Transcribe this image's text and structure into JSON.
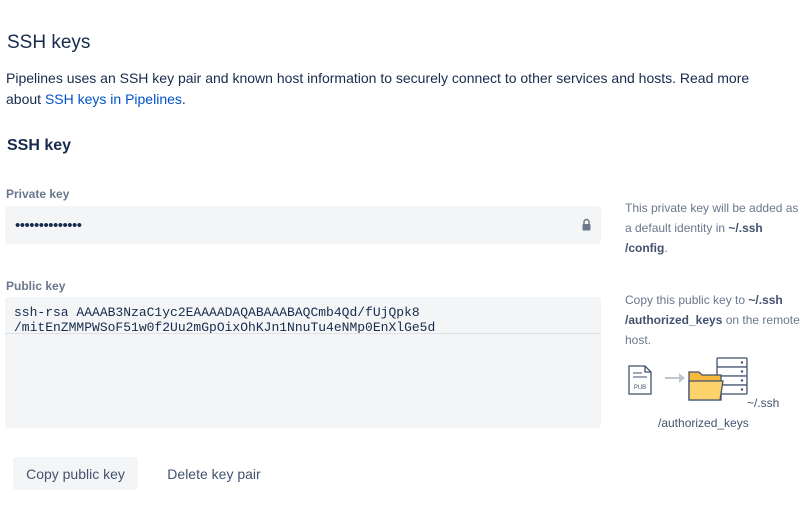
{
  "header": {
    "title": "SSH keys",
    "intro_text": "Pipelines uses an SSH key pair and known host information to securely connect to other services and hosts. Read more about ",
    "intro_link": "SSH keys in Pipelines",
    "intro_end": "."
  },
  "section": {
    "title": "SSH key"
  },
  "private_key": {
    "label": "Private key",
    "masked_value": "••••••••••••••",
    "help_prefix": "This private key will be added as a default identity in ",
    "help_path": "~/.ssh /config",
    "help_suffix": "."
  },
  "public_key": {
    "label": "Public key",
    "value": "ssh-rsa AAAAB3NzaC1yc2EAAAADAQABAAABAQCmb4Qd/fUjQpk8\n/mitEnZMMPWSoF51w0f2Uu2mGpOixOhKJn1NnuTu4eNMp0EnXlGe5d",
    "help_prefix": "Copy this public key to ",
    "help_path": "~/.ssh /authorized_keys",
    "help_suffix": " on the remote host.",
    "illustration": {
      "file_label": "PUB",
      "path_top": "~/.ssh",
      "path_bottom": "/authorized_keys"
    }
  },
  "actions": {
    "copy_label": "Copy public key",
    "delete_label": "Delete key pair"
  },
  "colors": {
    "text": "#172b4d",
    "muted": "#6b778c",
    "link": "#0052cc",
    "field_bg": "#f4f5f7",
    "folder": "#f6b93b"
  }
}
